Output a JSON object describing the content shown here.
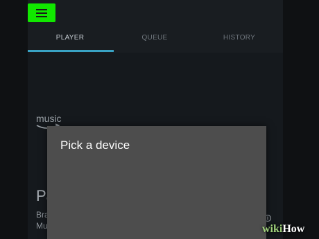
{
  "header": {
    "menu_icon": "hamburger-menu-icon",
    "highlight_color": "#11e800",
    "tabs": [
      {
        "label": "PLAYER",
        "active": true
      },
      {
        "label": "QUEUE",
        "active": false
      },
      {
        "label": "HISTORY",
        "active": false
      }
    ],
    "active_tab_color": "#39a3c4"
  },
  "logo": {
    "text": "music",
    "icon": "amazon-smile-icon"
  },
  "now_playing": {
    "title": "Pa",
    "artist": "Bra",
    "album": "Mu"
  },
  "dialog": {
    "title": "Pick a device"
  },
  "watermark": {
    "wiki": "wiki",
    "how": "How"
  }
}
